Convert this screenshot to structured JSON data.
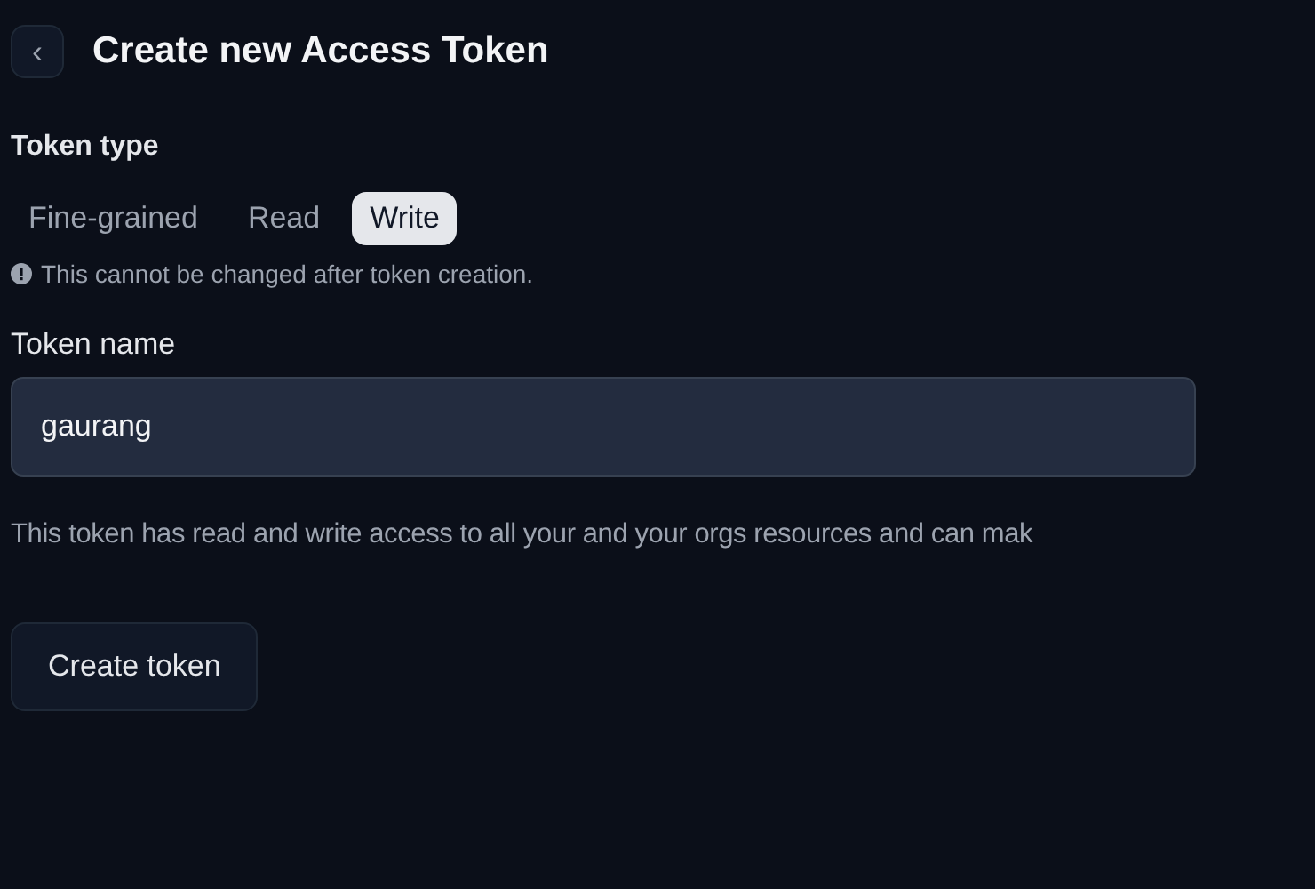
{
  "header": {
    "back_icon": "‹",
    "title": "Create new Access Token"
  },
  "token_type": {
    "label": "Token type",
    "options": [
      {
        "label": "Fine-grained",
        "selected": false
      },
      {
        "label": "Read",
        "selected": false
      },
      {
        "label": "Write",
        "selected": true
      }
    ],
    "note": "This cannot be changed after token creation."
  },
  "token_name": {
    "label": "Token name",
    "value": "gaurang"
  },
  "description": "This token has read and write access to all your and your orgs resources and can mak",
  "buttons": [
    "Create token"
  ]
}
